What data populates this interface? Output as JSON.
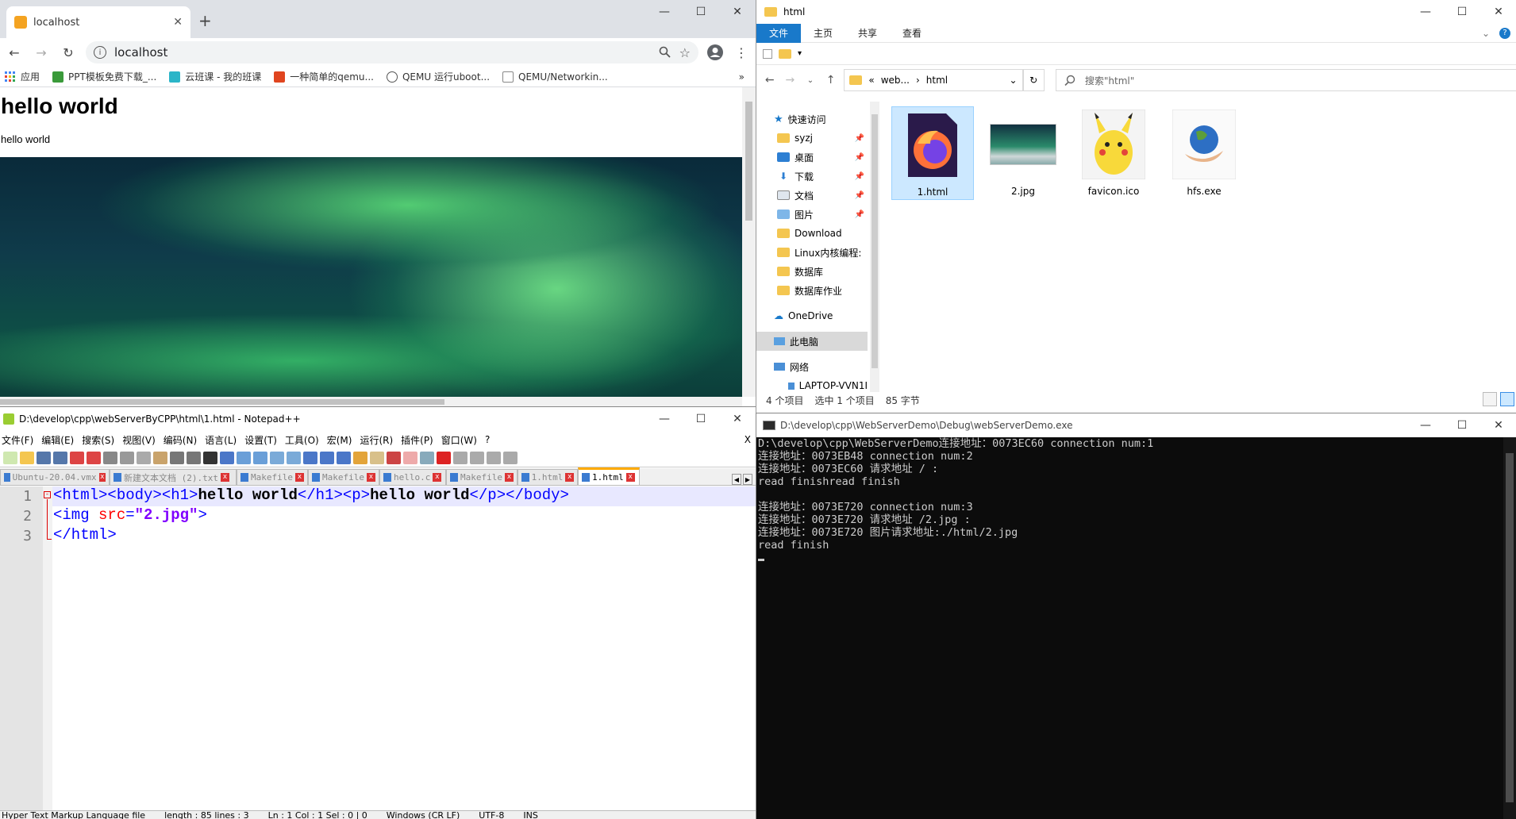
{
  "chrome": {
    "tab_title": "localhost",
    "new_tab": "+",
    "url": "localhost",
    "bookmarks": [
      "应用",
      "PPT模板免费下载_...",
      "云班课 - 我的班课",
      "一种简单的qemu...",
      "QEMU 运行uboot...",
      "QEMU/Networkin..."
    ],
    "bookmarks_more": "»",
    "page": {
      "h1": "hello world",
      "p": "hello world"
    }
  },
  "explorer": {
    "title": "html",
    "ribbon_tabs": [
      "文件",
      "主页",
      "共享",
      "查看"
    ],
    "path": [
      "«",
      "web...",
      "›",
      "html"
    ],
    "search_placeholder": "搜索\"html\"",
    "nav": {
      "quick_access": "快速访问",
      "items": [
        "syzj",
        "桌面",
        "下载",
        "文档",
        "图片",
        "Download",
        "Linux内核编程:",
        "数据库",
        "数据库作业"
      ],
      "onedrive": "OneDrive",
      "this_pc": "此电脑",
      "network": "网络",
      "laptop": "LAPTOP-VVN1I"
    },
    "files": [
      {
        "name": "1.html",
        "icon": "firefox-icon"
      },
      {
        "name": "2.jpg",
        "icon": "image-thumbnail"
      },
      {
        "name": "favicon.ico",
        "icon": "pikachu-icon"
      },
      {
        "name": "hfs.exe",
        "icon": "globe-hand-icon"
      }
    ],
    "status": {
      "count": "4 个项目",
      "selected": "选中 1 个项目",
      "size": "85 字节"
    }
  },
  "npp": {
    "title": "D:\\develop\\cpp\\webServerByCPP\\html\\1.html - Notepad++",
    "menu": [
      "文件(F)",
      "编辑(E)",
      "搜索(S)",
      "视图(V)",
      "编码(N)",
      "语言(L)",
      "设置(T)",
      "工具(O)",
      "宏(M)",
      "运行(R)",
      "插件(P)",
      "窗口(W)",
      "?"
    ],
    "menu_close": "X",
    "tabs": [
      "Ubuntu-20.04.vmx",
      "新建文本文档 (2).txt",
      "Makefile",
      "Makefile",
      "hello.c",
      "Makefile",
      "1.html",
      "1.html"
    ],
    "line_numbers": [
      "1",
      "2",
      "3"
    ],
    "status": {
      "type": "Hyper Text Markup Language file",
      "length": "length : 85    lines : 3",
      "pos": "Ln : 1    Col : 1    Sel : 0 | 0",
      "eol": "Windows (CR LF)",
      "enc": "UTF-8",
      "ins": "INS"
    }
  },
  "console": {
    "title": "D:\\develop\\cpp\\WebServerDemo\\Debug\\webServerDemo.exe",
    "lines": [
      "D:\\develop\\cpp\\WebServerDemo连接地址：0073EC60 connection num:1",
      "连接地址：0073EB48 connection num:2",
      "连接地址：0073EC60 请求地址 / :",
      "read finishread finish",
      "",
      "连接地址：0073E720 connection num:3",
      "连接地址：0073E720 请求地址 /2.jpg :",
      "连接地址：0073E720 图片请求地址:./html/2.jpg",
      "read finish"
    ]
  },
  "colors": {
    "ribbon_active": "#1979ca",
    "selection": "#cce8ff",
    "console_bg": "#0c0c0c"
  }
}
